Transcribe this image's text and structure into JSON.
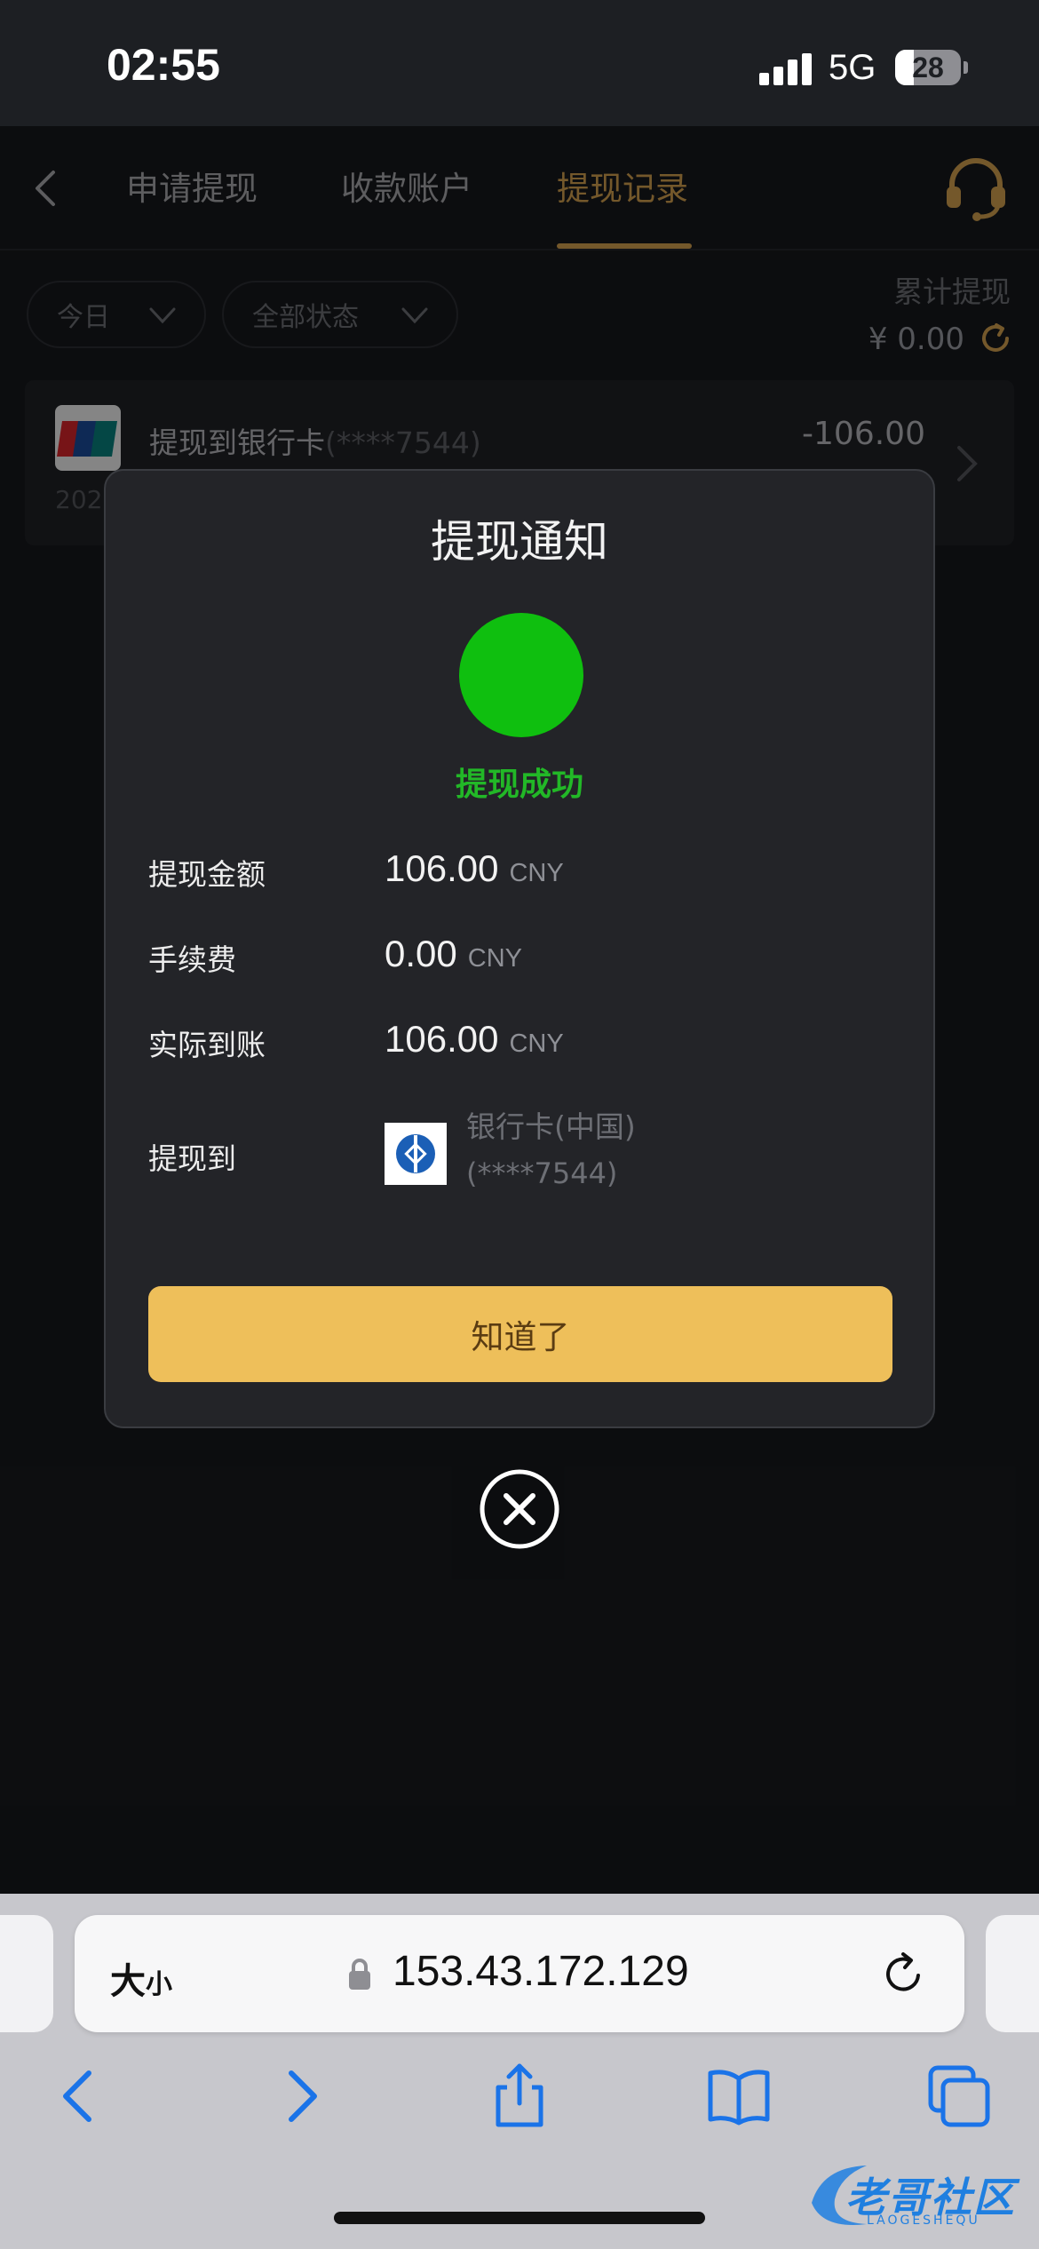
{
  "status_bar": {
    "time": "02:55",
    "network": "5G",
    "battery": "28",
    "battery_fraction": 0.28
  },
  "nav": {
    "tabs": [
      {
        "label": "申请提现",
        "active": false
      },
      {
        "label": "收款账户",
        "active": false
      },
      {
        "label": "提现记录",
        "active": true
      }
    ],
    "accent_color": "#d3a04f"
  },
  "filters": {
    "date": "今日",
    "status": "全部状态"
  },
  "summary": {
    "label": "累计提现",
    "value": "¥ 0.00"
  },
  "record": {
    "title": "提现到银行卡",
    "mask": "(****7544)",
    "amount": "-106.00",
    "date_prefix": "202"
  },
  "modal": {
    "title": "提现通知",
    "status_text": "提现成功",
    "status_color": "#22b827",
    "rows": [
      {
        "label": "提现金额",
        "value": "106.00",
        "unit": "CNY"
      },
      {
        "label": "手续费",
        "value": "0.00",
        "unit": "CNY"
      },
      {
        "label": "实际到账",
        "value": "106.00",
        "unit": "CNY"
      }
    ],
    "destination_label": "提现到",
    "bank_name": "银行卡(中国)",
    "bank_mask": "(****7544)",
    "confirm_label": "知道了",
    "confirm_color": "#eebf5a"
  },
  "browser": {
    "text_size_big": "大",
    "text_size_small": "小",
    "url": "153.43.172.129",
    "toolbar_icons": [
      "back-icon",
      "forward-icon",
      "share-icon",
      "bookmarks-icon",
      "tabs-icon"
    ]
  },
  "watermark": {
    "text": "老哥社区",
    "sub": "LAOGESHEQU"
  }
}
